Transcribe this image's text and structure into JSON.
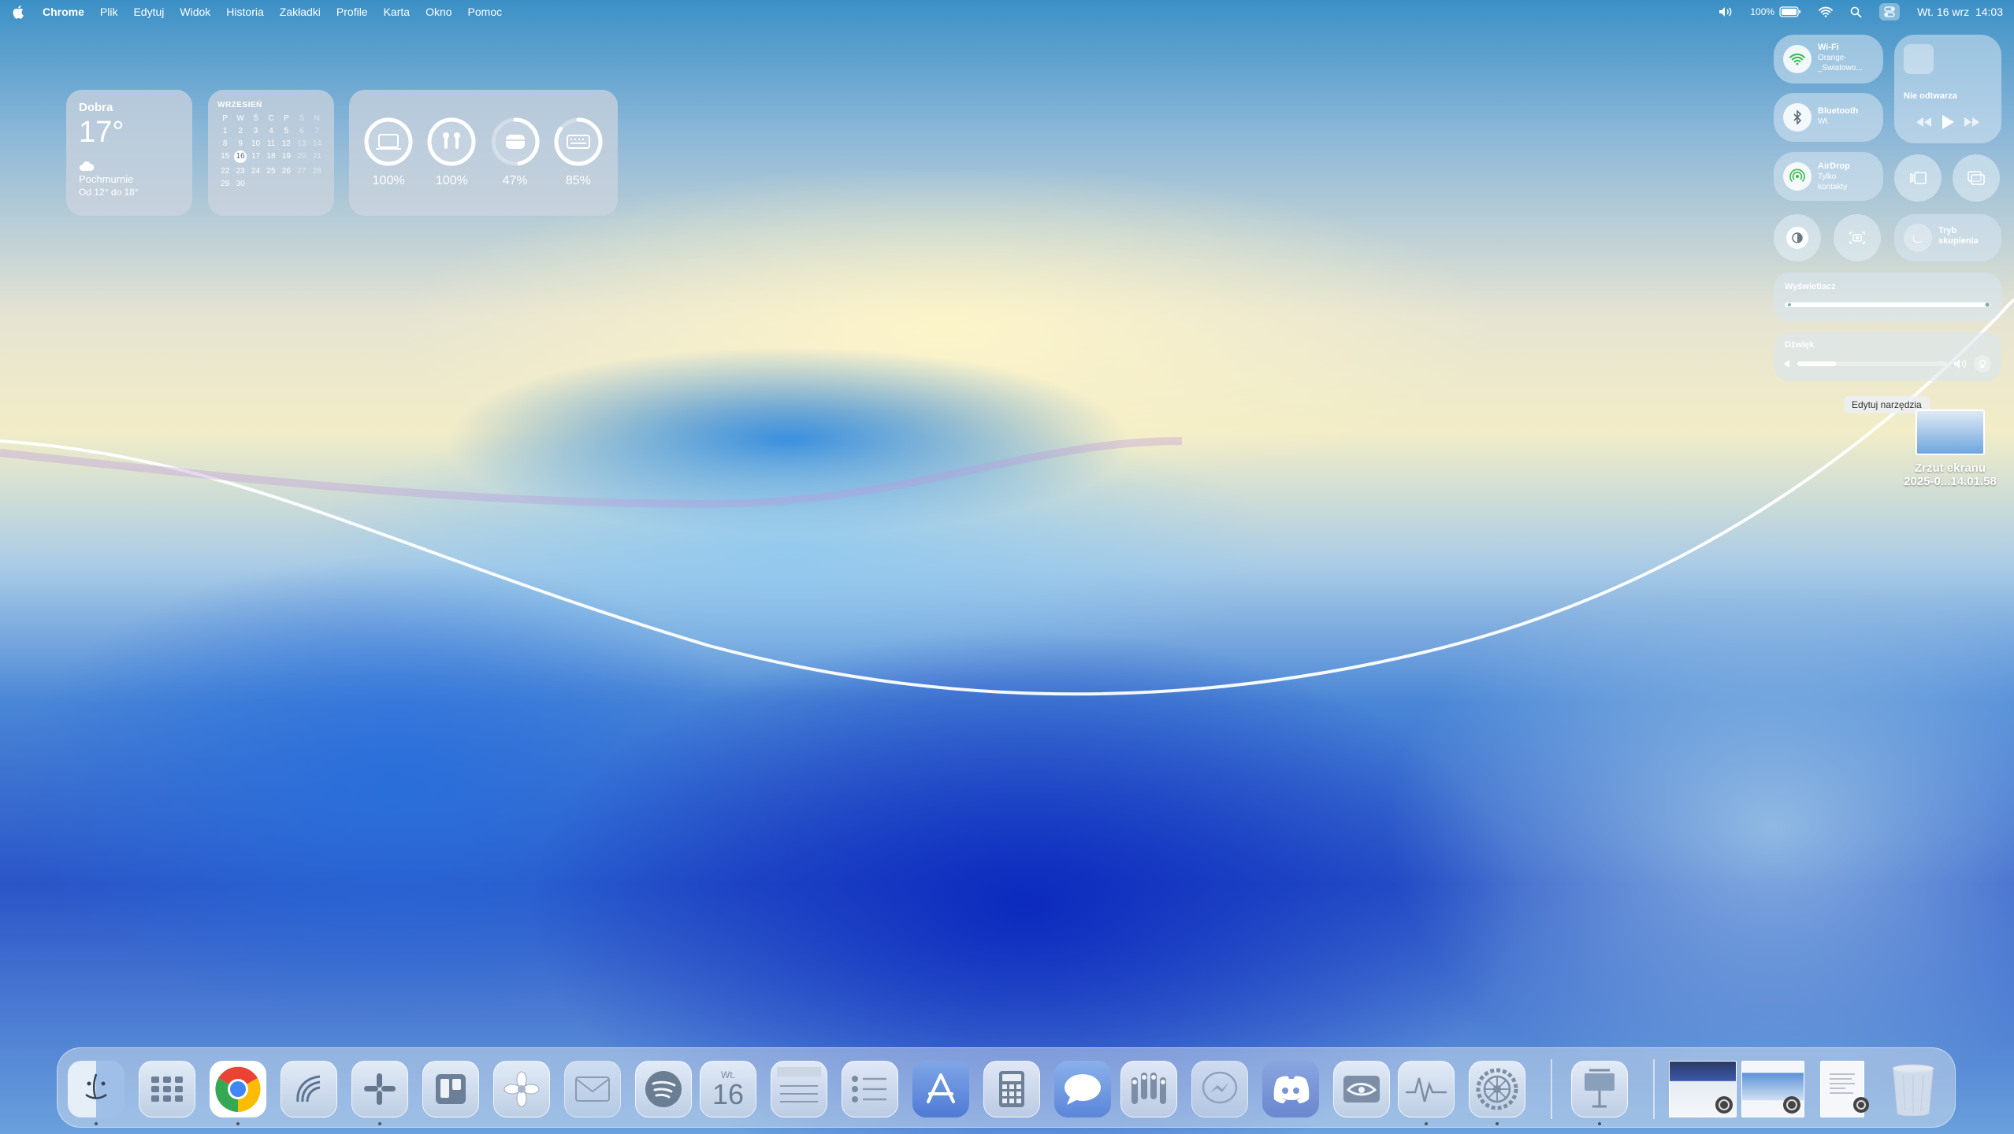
{
  "menubar": {
    "app_name": "Chrome",
    "menus": [
      "Plik",
      "Edytuj",
      "Widok",
      "Historia",
      "Zakładki",
      "Profile",
      "Karta",
      "Okno",
      "Pomoc"
    ],
    "battery_percent": "100%",
    "clock": "Wt. 16 wrz  14:03"
  },
  "weather": {
    "city": "Dobra",
    "temperature": "17°",
    "condition": "Pochmurnie",
    "range": "Od 12° do 18°"
  },
  "calendar": {
    "month": "WRZESIEŃ",
    "weekdays": [
      "P",
      "W",
      "Ś",
      "C",
      "P",
      "S",
      "N"
    ],
    "days": [
      "1",
      "2",
      "3",
      "4",
      "5",
      "6",
      "7",
      "8",
      "9",
      "10",
      "11",
      "12",
      "13",
      "14",
      "15",
      "16",
      "17",
      "18",
      "19",
      "20",
      "21",
      "22",
      "23",
      "24",
      "25",
      "26",
      "27",
      "28",
      "29",
      "30"
    ],
    "today": "16"
  },
  "batteries": {
    "items": [
      {
        "device_icon": "laptop-icon",
        "percent": "100%",
        "level": 1.0
      },
      {
        "device_icon": "airpods-icon",
        "percent": "100%",
        "level": 1.0
      },
      {
        "device_icon": "airpods-case-icon",
        "percent": "47%",
        "level": 0.47
      },
      {
        "device_icon": "keyboard-icon",
        "percent": "85%",
        "level": 0.85
      }
    ]
  },
  "control_center": {
    "wifi": {
      "title": "Wi-Fi",
      "subtitle": "Orange-_Swiatowo..."
    },
    "bluetooth": {
      "title": "Bluetooth",
      "subtitle": "Wł."
    },
    "airdrop": {
      "title": "AirDrop",
      "subtitle": "Tylko kontakty"
    },
    "now_playing": {
      "status": "Nie odtwarza"
    },
    "focus": {
      "title": "Tryb skupienia"
    },
    "display": {
      "title": "Wyświetlacz",
      "level": 0.98
    },
    "sound": {
      "title": "Dźwięk",
      "level": 0.26
    },
    "edit_tooltip": "Edytuj narzędzia"
  },
  "desktop_file": {
    "name_line1": "Zrzut ekranu",
    "name_line2": "2025-0...14.01.58"
  },
  "dock": {
    "calendar_weekday": "Wt.",
    "calendar_day": "16",
    "apps": [
      "finder-icon",
      "launchpad-icon",
      "chrome-icon",
      "surfshark-icon",
      "slack-icon",
      "trello-icon",
      "photos-icon",
      "mail-icon",
      "spotify-icon",
      "calendar-icon",
      "notes-icon",
      "reminders-icon",
      "app-store-icon",
      "calculator-icon",
      "messages-icon",
      "airpods-settings-icon",
      "messenger-icon",
      "discord-icon",
      "nvidia-icon",
      "activity-monitor-icon",
      "system-settings-icon"
    ]
  },
  "colors": {
    "chrome_red": "#ea4335",
    "chrome_yellow": "#fbbc05",
    "chrome_green": "#34a853",
    "chrome_blue": "#4285f4",
    "wifi_green": "#2fbf4a"
  }
}
